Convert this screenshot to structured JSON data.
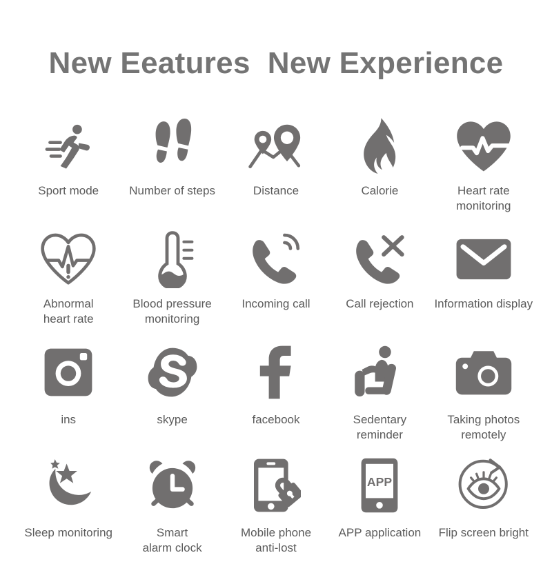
{
  "header": {
    "title": "New Eeatures  New Experience",
    "title_color": "#747474"
  },
  "theme": {
    "background": "#ffffff",
    "icon_color": "#716f6f",
    "label_color": "#5b5b5b"
  },
  "features": [
    {
      "icon": "running-man-icon",
      "label": "Sport mode"
    },
    {
      "icon": "footprints-icon",
      "label": "Number of steps"
    },
    {
      "icon": "map-pins-icon",
      "label": "Distance"
    },
    {
      "icon": "flame-icon",
      "label": "Calorie"
    },
    {
      "icon": "heart-pulse-filled-icon",
      "label": "Heart rate\nmonitoring"
    },
    {
      "icon": "heart-pulse-outline-alert-icon",
      "label": "Abnormal\nheart rate"
    },
    {
      "icon": "thermometer-icon",
      "label": "Blood pressure\nmonitoring"
    },
    {
      "icon": "phone-ringing-icon",
      "label": "Incoming call"
    },
    {
      "icon": "phone-reject-icon",
      "label": "Call rejection"
    },
    {
      "icon": "envelope-icon",
      "label": "Information display"
    },
    {
      "icon": "instagram-icon",
      "label": "ins"
    },
    {
      "icon": "skype-icon",
      "label": "skype"
    },
    {
      "icon": "facebook-icon",
      "label": "facebook"
    },
    {
      "icon": "sitting-person-icon",
      "label": "Sedentary\nreminder"
    },
    {
      "icon": "camera-icon",
      "label": "Taking photos\nremotely"
    },
    {
      "icon": "moon-stars-icon",
      "label": "Sleep monitoring"
    },
    {
      "icon": "alarm-clock-icon",
      "label": "Smart\nalarm clock"
    },
    {
      "icon": "phone-lock-icon",
      "label": "Mobile phone\nanti-lost"
    },
    {
      "icon": "phone-app-icon",
      "label": "APP application"
    },
    {
      "icon": "eye-rotate-icon",
      "label": "Flip screen bright"
    }
  ]
}
